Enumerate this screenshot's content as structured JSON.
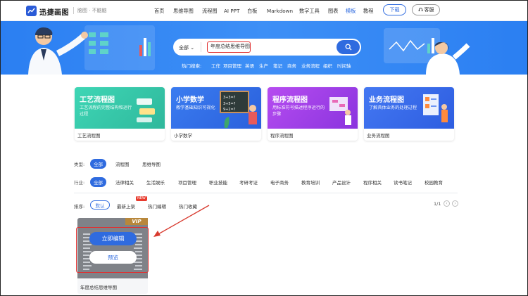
{
  "header": {
    "brand": "迅捷画图",
    "slogan": "脑图 · 不脑脑",
    "nav": [
      "首页",
      "思维导图",
      "流程图",
      "AI PPT",
      "白板",
      "Markdown",
      "数字工具",
      "图表",
      "模板",
      "教程"
    ],
    "active_nav": "模板",
    "download_label": "下载",
    "service_label": "客服"
  },
  "search": {
    "category": "全部",
    "query": "年度总结思维导图",
    "hot_label": "热门搜索:",
    "hot_terms": [
      "工作",
      "项目管理",
      "英语",
      "生产",
      "笔记",
      "商务",
      "业务流程",
      "组织",
      "时间轴"
    ]
  },
  "cards": [
    {
      "title": "工艺流程图",
      "desc": "工艺流程的完整结构和运行过程",
      "label": "工艺流程图",
      "color": "#34c6a8"
    },
    {
      "title": "小学数学",
      "desc": "教学基础知识可视化",
      "label": "小学数学",
      "color": "#2f6fe6"
    },
    {
      "title": "程序流程图",
      "desc": "用标准符号描述程序运行的步骤",
      "label": "程序流程图",
      "color": "#a23ee6"
    },
    {
      "title": "业务流程图",
      "desc": "了解具体业务的处理过程",
      "label": "业务流程图",
      "color": "#3565e8"
    }
  ],
  "filters": {
    "type_label": "类型:",
    "types": [
      "全部",
      "流程图",
      "思维导图"
    ],
    "industry_label": "行业:",
    "industries": [
      "全部",
      "法律相关",
      "生活娱乐",
      "项目管理",
      "职业技能",
      "考研考证",
      "电子商务",
      "教育培训",
      "产品设计",
      "程序相关",
      "读书笔记",
      "校园教育"
    ]
  },
  "sort": {
    "label": "排序:",
    "options": [
      "默认",
      "最新上架",
      "热门编辑",
      "热门收藏"
    ],
    "new_badge": "NEW",
    "page": "1/1"
  },
  "template": {
    "vip": "VIP",
    "edit_label": "立即编辑",
    "preview_label": "预览",
    "title": "年度总结思维导图"
  }
}
